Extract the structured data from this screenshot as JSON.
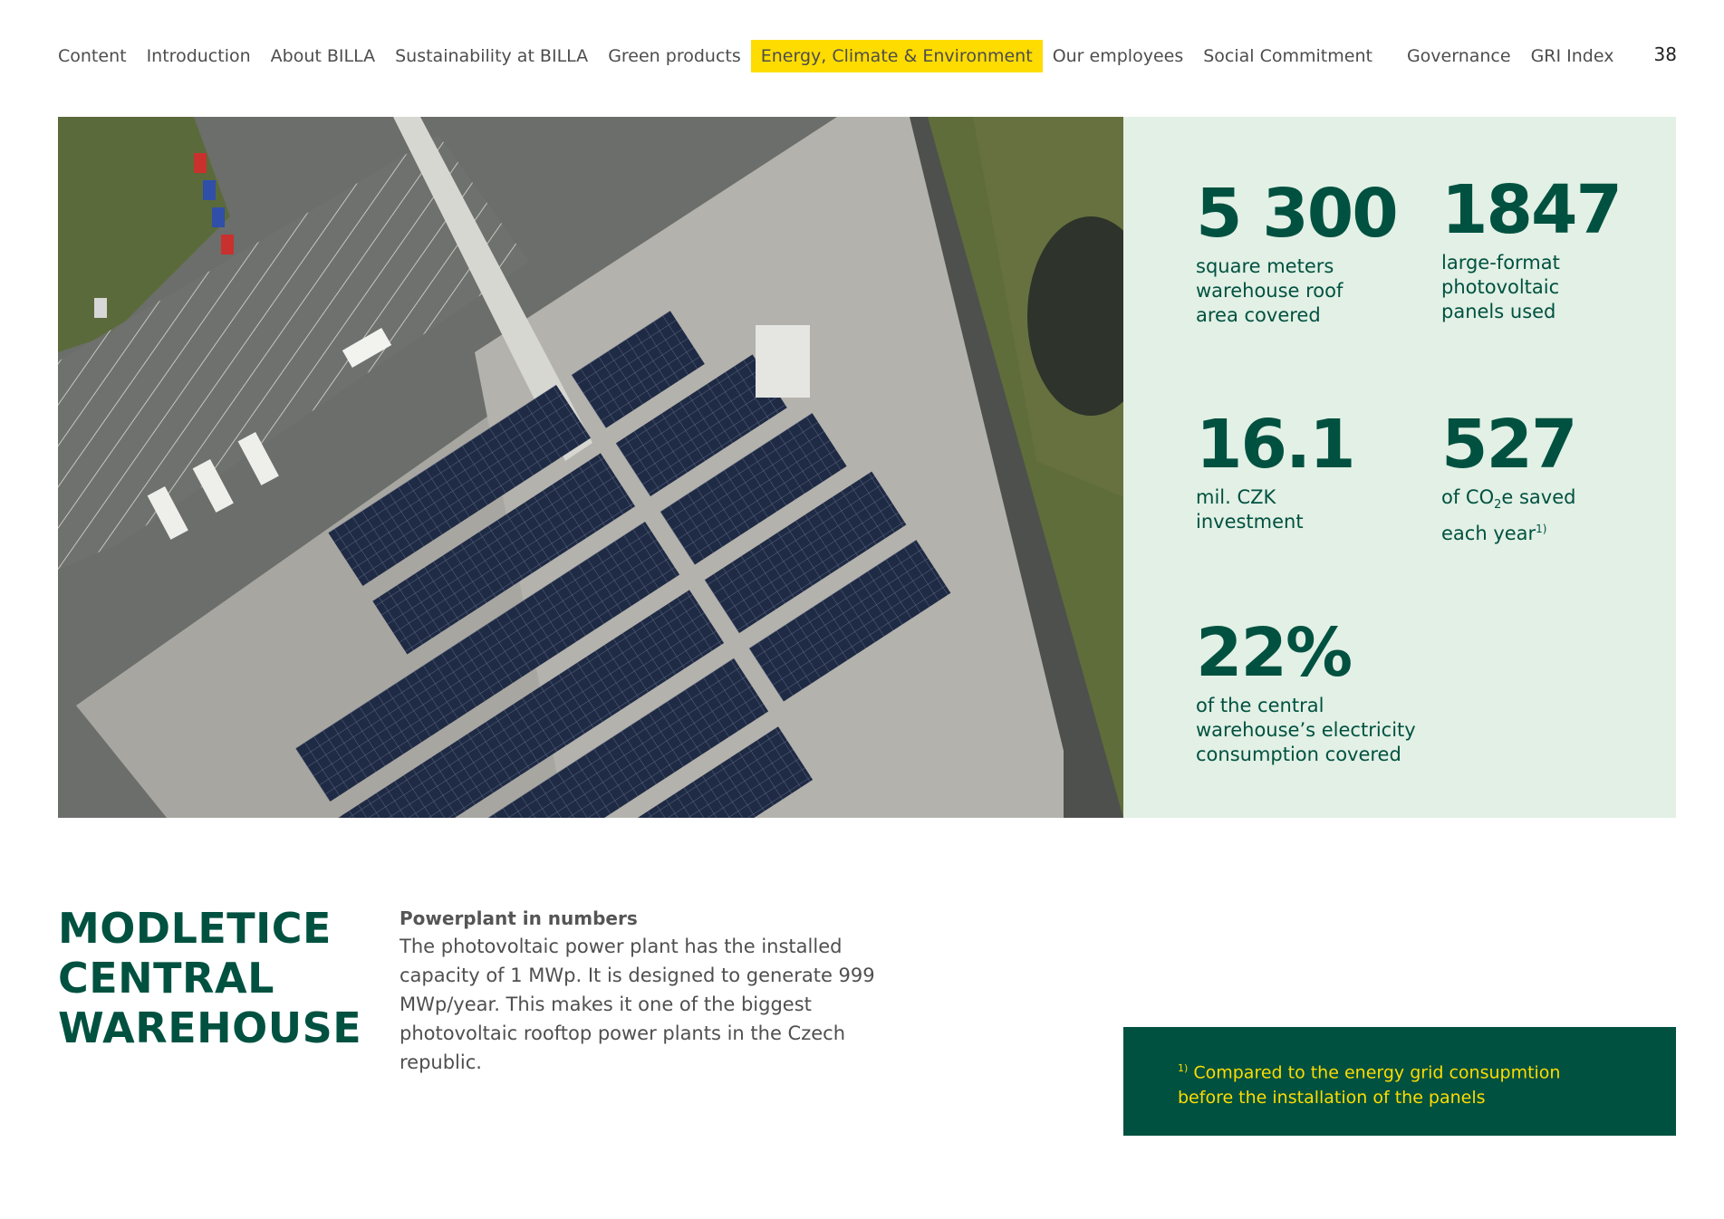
{
  "nav": {
    "items": [
      {
        "label": "Content"
      },
      {
        "label": "Introduction"
      },
      {
        "label": "About BILLA"
      },
      {
        "label": "Sustainability at BILLA"
      },
      {
        "label": "Green products"
      },
      {
        "label": "Energy, Climate & Environment",
        "active": true
      },
      {
        "label": "Our employees"
      },
      {
        "label": "Social Commitment"
      },
      {
        "label": "Governance"
      },
      {
        "label": "GRI Index"
      }
    ],
    "active_color": "#ffdc00"
  },
  "page_number": "38",
  "stats": {
    "roof": {
      "value": "5 300",
      "label": "square meters\nwarehouse roof\narea covered"
    },
    "panels": {
      "value": "1847",
      "label": "large-format\nphotovoltaic\npanels used"
    },
    "investment": {
      "value": "16.1",
      "label": "mil. CZK\ninvestment"
    },
    "co2": {
      "value": "527",
      "label_before": "of CO",
      "label_sub": "2",
      "label_after": "e saved",
      "label_line2": "each year",
      "label_sup": "1)"
    },
    "share": {
      "value": "22%",
      "label": "of the central\nwarehouse’s electricity\nconsumption covered"
    }
  },
  "headline": {
    "line1": "MODLETICE",
    "line2": "CENTRAL",
    "line3": "WAREHOUSE"
  },
  "body": {
    "title": "Powerplant in numbers",
    "text": "The photovoltaic power plant has the installed capacity of 1 MWp. It is designed to generate 999 MWp/year. This makes it one of the biggest photovoltaic rooftop power plants in the Czech republic."
  },
  "footnote": {
    "marker": "1)",
    "line1": " Compared to the energy grid consupmtion",
    "line2": "before the installation of the panels"
  },
  "colors": {
    "brand_green": "#005140",
    "panel_bg": "#e2f0e5",
    "accent_yellow": "#ffdc00"
  }
}
